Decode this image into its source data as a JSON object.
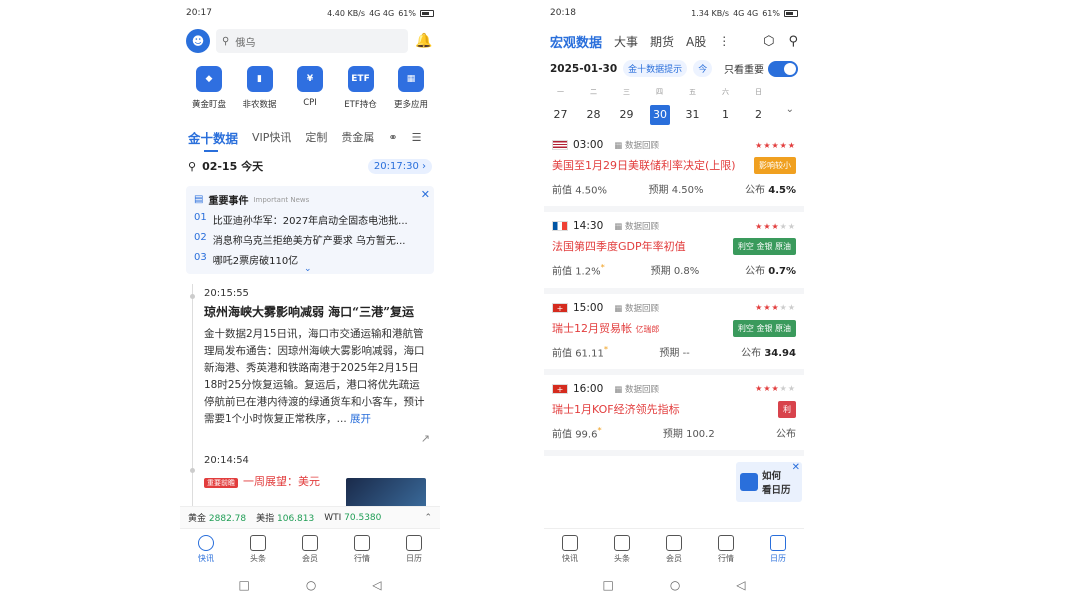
{
  "left": {
    "status": {
      "time": "20:17",
      "net": "4.40 KB/s",
      "signal": "4G 4G",
      "battery": "61%"
    },
    "search": {
      "placeholder": "俄乌"
    },
    "quick": [
      {
        "label": "黄金盯盘",
        "color": "#2f6fe0",
        "glyph": "◆"
      },
      {
        "label": "非农数据",
        "color": "#2f6fe0",
        "glyph": "▮"
      },
      {
        "label": "CPI",
        "color": "#2f6fe0",
        "glyph": "¥"
      },
      {
        "label": "ETF持仓",
        "color": "#2f6fe0",
        "glyph": "ETF"
      },
      {
        "label": "更多应用",
        "color": "#2f6fe0",
        "glyph": "▦"
      }
    ],
    "navtabs": [
      "金十数据",
      "VIP快讯",
      "定制",
      "贵金属"
    ],
    "date": {
      "label": "02-15 今天",
      "time": "20:17:30 ›"
    },
    "important": {
      "title": "重要事件",
      "subtitle": "Important News",
      "items": [
        {
          "num": "01",
          "text": "比亚迪孙华军：2027年启动全固态电池批..."
        },
        {
          "num": "02",
          "text": "消息称乌克兰拒绝美方矿产要求 乌方暂无..."
        },
        {
          "num": "03",
          "text": "哪吒2票房破110亿"
        }
      ]
    },
    "news1": {
      "time": "20:15:55",
      "title": "琼州海峡大雾影响减弱 海口“三港”复运",
      "body": "金十数据2月15日讯，海口市交通运输和港航管理局发布通告：因琼州海峡大雾影响减弱，海口新海港、秀英港和铁路南港于2025年2月15日18时25分恢复运输。复运后，港口将优先疏运停航前已在港内待渡的绿通货车和小客车，预计需要1个小时恢复正常秩序，...",
      "more": "展开"
    },
    "news2": {
      "time": "20:14:54",
      "badge": "重要前瞻",
      "title": "一周展望：美元"
    },
    "ticker": [
      {
        "name": "黄金",
        "value": "2882.78"
      },
      {
        "name": "美指",
        "value": "106.813"
      },
      {
        "name": "WTI",
        "value": "70.5380"
      }
    ],
    "tabbar": [
      "快讯",
      "头条",
      "会员",
      "行情",
      "日历"
    ]
  },
  "right": {
    "status": {
      "time": "20:18",
      "net": "1.34 KB/s",
      "signal": "4G 4G",
      "battery": "61%"
    },
    "tabs": [
      "宏观数据",
      "大事",
      "期货",
      "A股"
    ],
    "filter": {
      "date": "2025-01-30",
      "hint": "金十数据提示",
      "k": "今",
      "toggle": "只看重要"
    },
    "weekdays": [
      "一",
      "二",
      "三",
      "四",
      "五",
      "六",
      "日"
    ],
    "days": [
      "27",
      "28",
      "29",
      "30",
      "31",
      "1",
      "2"
    ],
    "events": [
      {
        "flag": "us",
        "time": "03:00",
        "db": "数据回顾",
        "stars": 5,
        "title": "美国至1月29日美联储利率决定(上限)",
        "title_small": "",
        "tag": "影响较小",
        "tag_color": "orange",
        "prev": "4.50%",
        "fore": "4.50%",
        "act": "4.5%",
        "prev_mark": ""
      },
      {
        "flag": "fr",
        "time": "14:30",
        "db": "数据回顾",
        "stars": 3,
        "title": "法国第四季度GDP年率初值",
        "title_small": "",
        "tag": "利空 金银 原油",
        "tag_color": "green",
        "prev": "1.2%",
        "fore": "0.8%",
        "act": "0.7%",
        "prev_mark": "*"
      },
      {
        "flag": "ch",
        "time": "15:00",
        "db": "数据回顾",
        "stars": 3,
        "title": "瑞士12月贸易帐",
        "title_small": "亿瑞郎",
        "tag": "利空 金银 原油",
        "tag_color": "green",
        "prev": "61.11",
        "fore": "--",
        "act": "34.94",
        "prev_mark": "*"
      },
      {
        "flag": "ch",
        "time": "16:00",
        "db": "数据回顾",
        "stars": 3,
        "title": "瑞士1月KOF经济领先指标",
        "title_small": "",
        "tag": "利",
        "tag_color": "red",
        "prev": "99.6",
        "fore": "100.2",
        "act": "",
        "prev_mark": "*"
      }
    ],
    "labels": {
      "prev": "前值",
      "fore": "预期",
      "act": "公布"
    },
    "popup": {
      "line1": "如何",
      "line2": "看日历"
    },
    "tabbar": [
      "快讯",
      "头条",
      "会员",
      "行情",
      "日历"
    ]
  }
}
